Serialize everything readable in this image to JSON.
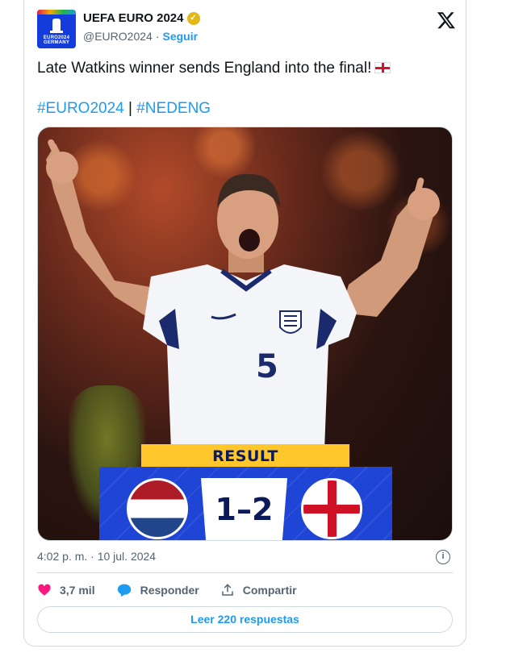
{
  "account": {
    "display_name": "UEFA EURO 2024",
    "handle": "@EURO2024",
    "separator": "·",
    "follow_label": "Seguir",
    "avatar_text": "EURO2024 GERMANY"
  },
  "tweet": {
    "text": "Late Watkins winner sends England into the final!",
    "hashtag_1": "#EURO2024",
    "hashtag_separator": "|",
    "hashtag_2": "#NEDENG"
  },
  "media": {
    "banner_label": "RESULT",
    "score": "1–2",
    "home_code": "NED",
    "away_code": "ENG",
    "shirt_number": "5",
    "colors": {
      "banner": "#ffc72c",
      "panel": "#1f45d6",
      "text_dark": "#0b1a5a"
    }
  },
  "meta": {
    "timestamp": "4:02 p. m. · 10 jul. 2024",
    "info_symbol": "i"
  },
  "actions": {
    "likes_count": "3,7 mil",
    "reply_label": "Responder",
    "share_label": "Compartir"
  },
  "replies_button": "Leer 220 respuestas",
  "colors": {
    "link": "#1d9bf0",
    "like": "#f91880",
    "muted": "#536471",
    "border": "#cfd9de"
  }
}
